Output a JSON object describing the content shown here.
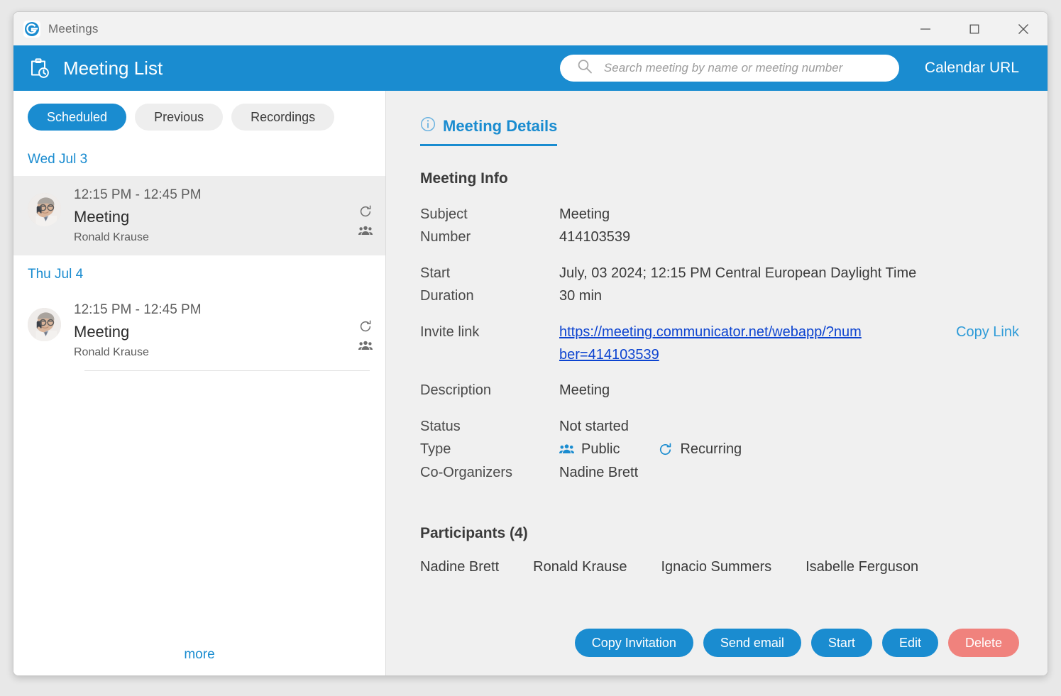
{
  "window": {
    "title": "Meetings",
    "app_icon": "communicator-logo-icon",
    "controls": {
      "minimize": "minimize-icon",
      "maximize": "maximize-icon",
      "close": "close-icon"
    }
  },
  "header": {
    "icon": "clipboard-clock-icon",
    "title": "Meeting List",
    "search_placeholder": "Search meeting by name or meeting number",
    "search_value": "",
    "search_icon": "search-icon",
    "calendar_url_label": "Calendar URL"
  },
  "sidebar": {
    "tabs": [
      {
        "label": "Scheduled",
        "active": true
      },
      {
        "label": "Previous",
        "active": false
      },
      {
        "label": "Recordings",
        "active": false
      }
    ],
    "groups": [
      {
        "date": "Wed Jul 3",
        "items": [
          {
            "time": "12:15 PM - 12:45 PM",
            "name": "Meeting",
            "owner": "Ronald Krause",
            "selected": true,
            "icons": [
              "recurring-icon",
              "participants-icon"
            ]
          }
        ]
      },
      {
        "date": "Thu Jul 4",
        "items": [
          {
            "time": "12:15 PM - 12:45 PM",
            "name": "Meeting",
            "owner": "Ronald Krause",
            "selected": false,
            "icons": [
              "recurring-icon",
              "participants-icon"
            ]
          }
        ]
      }
    ],
    "more_label": "more"
  },
  "details": {
    "tab_label": "Meeting Details",
    "tab_icon": "info-circle-icon",
    "section_title": "Meeting Info",
    "fields": {
      "subject_label": "Subject",
      "subject_value": "Meeting",
      "number_label": "Number",
      "number_value": "414103539",
      "start_label": "Start",
      "start_value": "July, 03 2024; 12:15 PM Central European Daylight Time",
      "duration_label": "Duration",
      "duration_value": "30 min",
      "invite_label": "Invite link",
      "invite_value": "https://meeting.communicator.net/webapp/?number=414103539",
      "copy_link_label": "Copy Link",
      "description_label": "Description",
      "description_value": "Meeting",
      "status_label": "Status",
      "status_value": "Not started",
      "type_label": "Type",
      "type_public": "Public",
      "type_recurring": "Recurring",
      "co_organizers_label": "Co-Organizers",
      "co_organizers_value": "Nadine Brett"
    },
    "participants_title": "Participants (4)",
    "participants": [
      "Nadine Brett",
      "Ronald Krause",
      "Ignacio Summers",
      "Isabelle Ferguson"
    ],
    "actions": [
      {
        "label": "Copy Invitation",
        "style": "primary"
      },
      {
        "label": "Send email",
        "style": "primary"
      },
      {
        "label": "Start",
        "style": "primary"
      },
      {
        "label": "Edit",
        "style": "primary"
      },
      {
        "label": "Delete",
        "style": "danger"
      }
    ]
  },
  "colors": {
    "accent": "#1a8cd0",
    "danger": "#f0827d",
    "link": "#0c43d0",
    "panel_bg": "#f0f0f0",
    "selected_row": "#ededed"
  }
}
